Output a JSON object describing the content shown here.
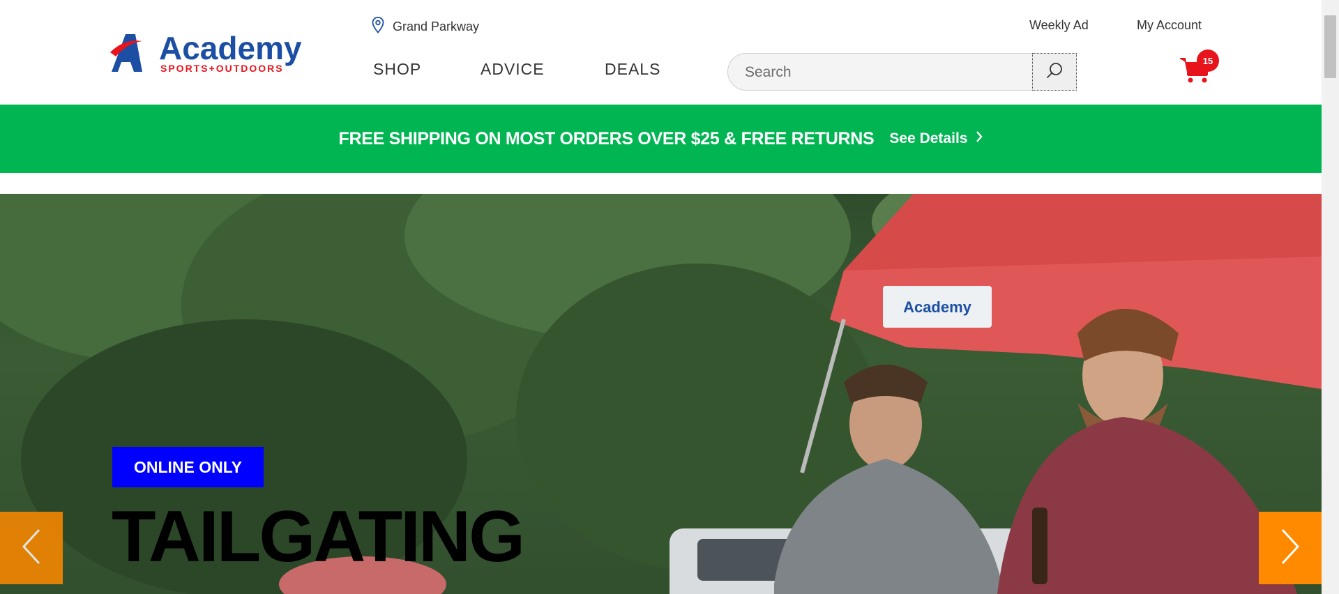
{
  "header": {
    "logo": {
      "brand": "Academy",
      "tagline": "SPORTS+OUTDOORS",
      "colors": {
        "blue": "#1c4fa3",
        "red": "#e8141c"
      }
    },
    "location": {
      "icon": "map-pin-icon",
      "label": "Grand Parkway"
    },
    "links": {
      "weekly_ad": "Weekly Ad",
      "my_account": "My Account"
    },
    "nav": {
      "shop": "SHOP",
      "advice": "ADVICE",
      "deals": "DEALS"
    },
    "search": {
      "placeholder": "Search",
      "value": "",
      "icon": "search-icon"
    },
    "cart": {
      "icon": "cart-icon",
      "count": "15"
    }
  },
  "promo": {
    "text": "FREE SHIPPING ON MOST ORDERS OVER $25 & FREE RETURNS",
    "link": "See Details",
    "color": "#00b552"
  },
  "hero": {
    "badge": "ONLINE ONLY",
    "headline": "TAILGATING",
    "tent_logo": "Academy",
    "arrow_color": "#ff8a00"
  }
}
